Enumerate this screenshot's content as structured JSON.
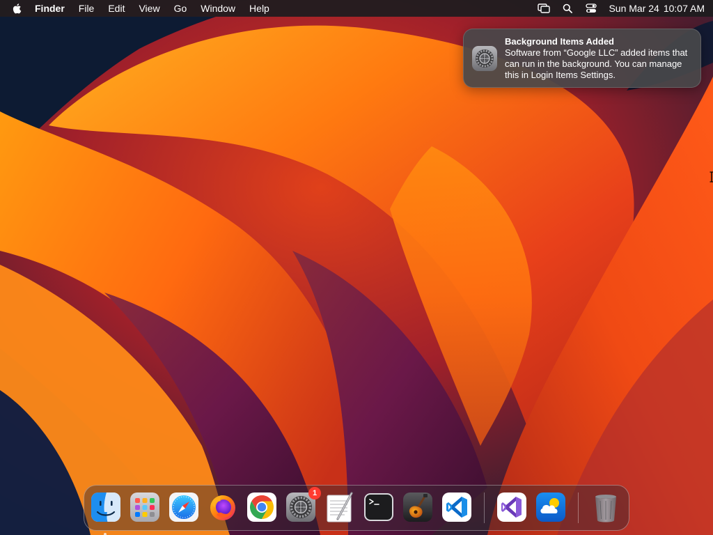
{
  "menubar": {
    "apple_icon": "apple-logo-icon",
    "app_name": "Finder",
    "menus": [
      "File",
      "Edit",
      "View",
      "Go",
      "Window",
      "Help"
    ],
    "status_icons": [
      "screen-mirroring-icon",
      "spotlight-search-icon",
      "control-center-icon"
    ],
    "clock": {
      "date": "Sun Mar 24",
      "time": "10:07 AM"
    }
  },
  "notification": {
    "icon": "system-settings-gear-icon",
    "title": "Background Items Added",
    "body": "Software from “Google LLC” added items that can run in the background. You can manage this in Login Items Settings."
  },
  "dock": {
    "apps": [
      {
        "name": "Finder",
        "icon": "finder-icon",
        "running": true
      },
      {
        "name": "Launchpad",
        "icon": "launchpad-icon"
      },
      {
        "name": "Safari",
        "icon": "safari-icon"
      },
      {
        "name": "Firefox",
        "icon": "firefox-icon"
      },
      {
        "name": "Google Chrome",
        "icon": "chrome-icon"
      },
      {
        "name": "System Settings",
        "icon": "system-settings-icon",
        "badge": "1"
      },
      {
        "name": "TextEdit",
        "icon": "textedit-icon"
      },
      {
        "name": "Terminal",
        "icon": "terminal-icon"
      },
      {
        "name": "GarageBand",
        "icon": "garageband-icon"
      },
      {
        "name": "Visual Studio Code",
        "icon": "vscode-icon"
      },
      {
        "name": "Visual Studio",
        "icon": "visual-studio-icon"
      },
      {
        "name": "Weather",
        "icon": "weather-icon"
      },
      {
        "name": "Trash",
        "icon": "trash-icon"
      }
    ]
  },
  "colors": {
    "menubar_bg": "#1c1c1e",
    "notification_bg": "#48484a",
    "badge": "#ff3b30",
    "wallpaper_orange": "#ff8c00",
    "wallpaper_purple": "#6e1a4a",
    "wallpaper_navy": "#0d1b33"
  }
}
